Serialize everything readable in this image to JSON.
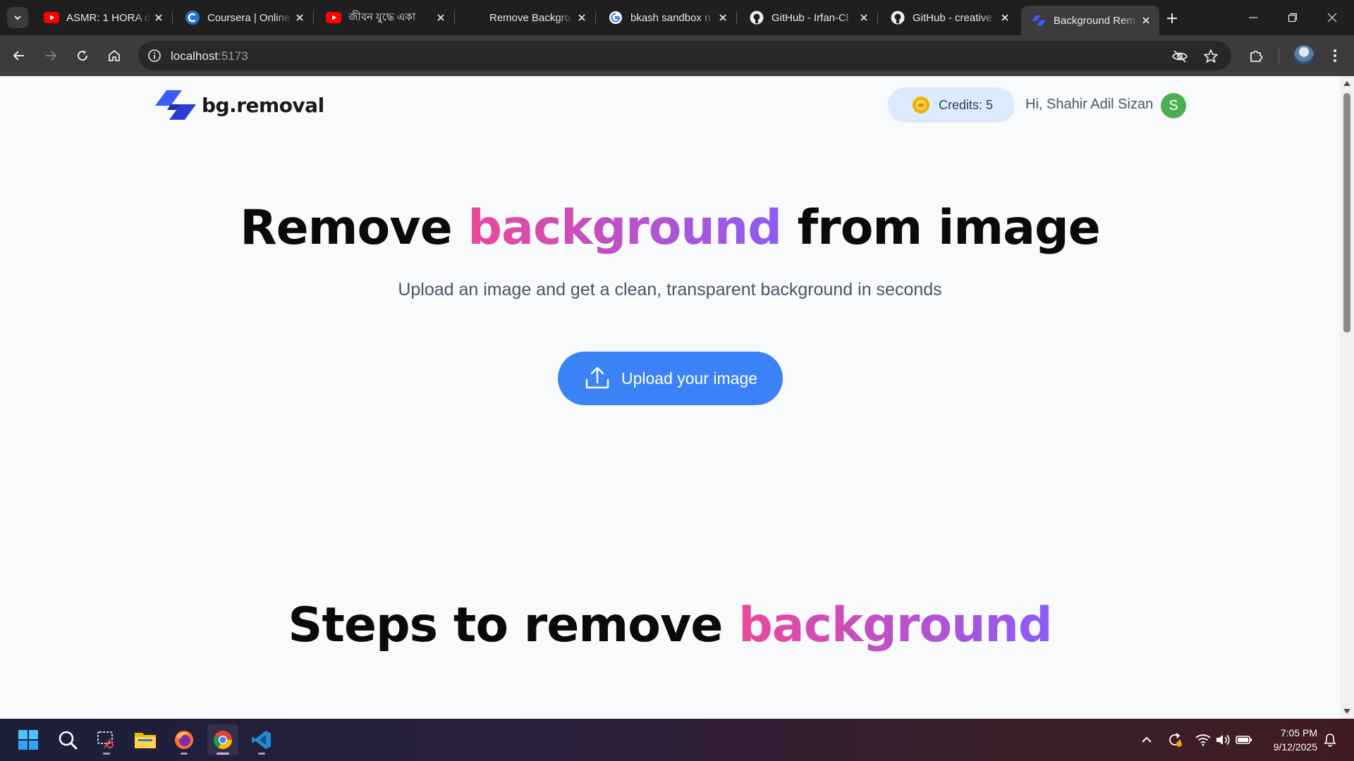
{
  "browser": {
    "tabs": [
      {
        "title": "ASMR: 1 HORA de",
        "favicon": "youtube-icon"
      },
      {
        "title": "Coursera | Online",
        "favicon": "coursera-icon"
      },
      {
        "title": "জীবন যুদ্ধে একা",
        "favicon": "youtube-icon"
      },
      {
        "title": "Remove Backgro",
        "favicon": "none"
      },
      {
        "title": "bkash sandbox n",
        "favicon": "google-icon"
      },
      {
        "title": "GitHub - Irfan-Cl",
        "favicon": "github-icon"
      },
      {
        "title": "GitHub - creative",
        "favicon": "github-icon"
      },
      {
        "title": "Background Rem",
        "favicon": "bg-removal-icon",
        "active": true
      }
    ],
    "address": {
      "host": "localhost",
      "port": ":5173"
    }
  },
  "header": {
    "logo_text": "bg.removal",
    "credits_label": "Credits: 5",
    "greeting": "Hi, Shahir Adil Sizan",
    "avatar_initial": "S"
  },
  "hero": {
    "title_part1": "Remove ",
    "title_highlight": "background",
    "title_part2": " from image",
    "subtitle": "Upload an image and get a clean, transparent background in seconds",
    "upload_label": "Upload your image"
  },
  "steps": {
    "title_part1": "Steps to remove ",
    "title_highlight": "background"
  },
  "taskbar": {
    "apps": [
      "windows-start-icon",
      "search-icon",
      "snipping-tool-icon",
      "file-explorer-icon",
      "firefox-icon",
      "chrome-icon",
      "vscode-icon"
    ],
    "time": "7:05 PM",
    "date": "9/12/2025"
  },
  "colors": {
    "accent_blue": "#3b82f6",
    "gradient_start": "#ec4899",
    "gradient_end": "#8b5cf6",
    "credits_bg": "#dbeafe",
    "avatar_green": "#4caf50"
  }
}
